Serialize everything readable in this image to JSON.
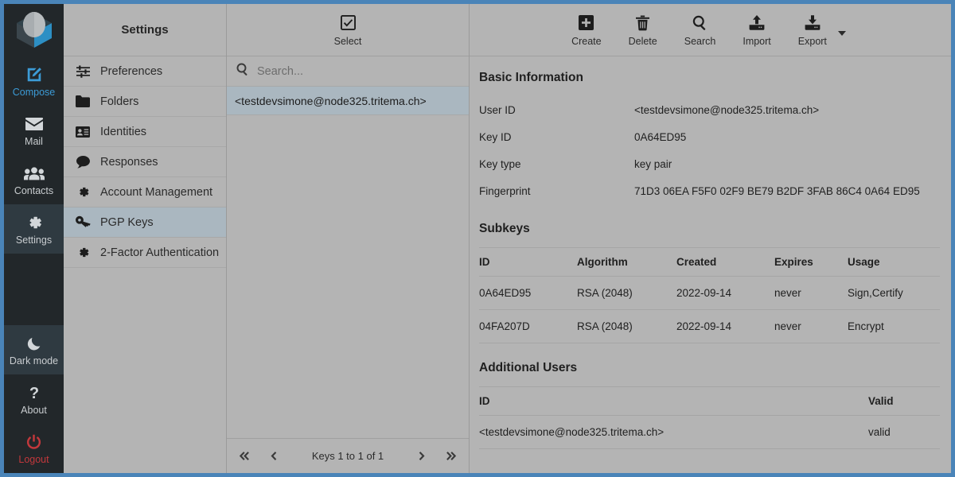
{
  "window": {
    "border_color": "#4a84b8",
    "background": "#b4b4b4"
  },
  "rail": {
    "logo_name": "app-logo",
    "items": [
      {
        "label": "Compose",
        "icon": "compose-pencil-icon",
        "state": "accent"
      },
      {
        "label": "Mail",
        "icon": "envelope-icon",
        "state": "normal"
      },
      {
        "label": "Contacts",
        "icon": "people-icon",
        "state": "normal"
      },
      {
        "label": "Settings",
        "icon": "gear-icon",
        "state": "active"
      },
      {
        "label": "Dark mode",
        "icon": "moon-icon",
        "state": "active-dim"
      },
      {
        "label": "About",
        "icon": "question-mark-icon",
        "state": "normal"
      },
      {
        "label": "Logout",
        "icon": "power-icon",
        "state": "danger"
      }
    ],
    "accent_color": "#3c9bd6",
    "danger_color": "#c2383c"
  },
  "settings_pane": {
    "title": "Settings",
    "items": [
      {
        "label": "Preferences",
        "icon": "sliders-icon",
        "selected": false
      },
      {
        "label": "Folders",
        "icon": "folder-icon",
        "selected": false
      },
      {
        "label": "Identities",
        "icon": "id-card-icon",
        "selected": false
      },
      {
        "label": "Responses",
        "icon": "chat-bubble-icon",
        "selected": false
      },
      {
        "label": "Account Management",
        "icon": "gear-icon",
        "selected": false
      },
      {
        "label": "PGP Keys",
        "icon": "key-icon",
        "selected": true
      },
      {
        "label": "2-Factor Authentication",
        "icon": "gear-icon",
        "selected": false
      }
    ]
  },
  "keys_pane": {
    "select_button": {
      "label": "Select",
      "icon": "checkbox-checked-icon"
    },
    "search": {
      "placeholder": "Search...",
      "value": "",
      "icon": "search-icon"
    },
    "rows": [
      {
        "label": "<testdevsimone@node325.tritema.ch>",
        "selected": true
      }
    ],
    "pager": {
      "first_icon": "double-chevron-left-icon",
      "prev_icon": "chevron-left-icon",
      "label": "Keys 1 to 1 of 1",
      "next_icon": "chevron-right-icon",
      "last_icon": "double-chevron-right-icon"
    }
  },
  "detail_toolbar": {
    "buttons": [
      {
        "label": "Create",
        "icon": "plus-square-icon"
      },
      {
        "label": "Delete",
        "icon": "trash-icon"
      },
      {
        "label": "Search",
        "icon": "search-icon"
      },
      {
        "label": "Import",
        "icon": "upload-icon"
      },
      {
        "label": "Export",
        "icon": "download-icon"
      }
    ],
    "export_caret": "chevron-down-icon"
  },
  "detail": {
    "basic_information": {
      "title": "Basic Information",
      "rows": [
        {
          "key": "User ID",
          "value": "<testdevsimone@node325.tritema.ch>"
        },
        {
          "key": "Key ID",
          "value": "0A64ED95"
        },
        {
          "key": "Key type",
          "value": "key pair"
        },
        {
          "key": "Fingerprint",
          "value": "71D3 06EA F5F0 02F9 BE79 B2DF 3FAB 86C4 0A64 ED95"
        }
      ]
    },
    "subkeys": {
      "title": "Subkeys",
      "columns": [
        "ID",
        "Algorithm",
        "Created",
        "Expires",
        "Usage"
      ],
      "rows": [
        [
          "0A64ED95",
          "RSA (2048)",
          "2022-09-14",
          "never",
          "Sign,Certify"
        ],
        [
          "04FA207D",
          "RSA (2048)",
          "2022-09-14",
          "never",
          "Encrypt"
        ]
      ]
    },
    "additional_users": {
      "title": "Additional Users",
      "columns": [
        "ID",
        "Valid"
      ],
      "rows": [
        [
          "<testdevsimone@node325.tritema.ch>",
          "valid"
        ]
      ]
    }
  }
}
